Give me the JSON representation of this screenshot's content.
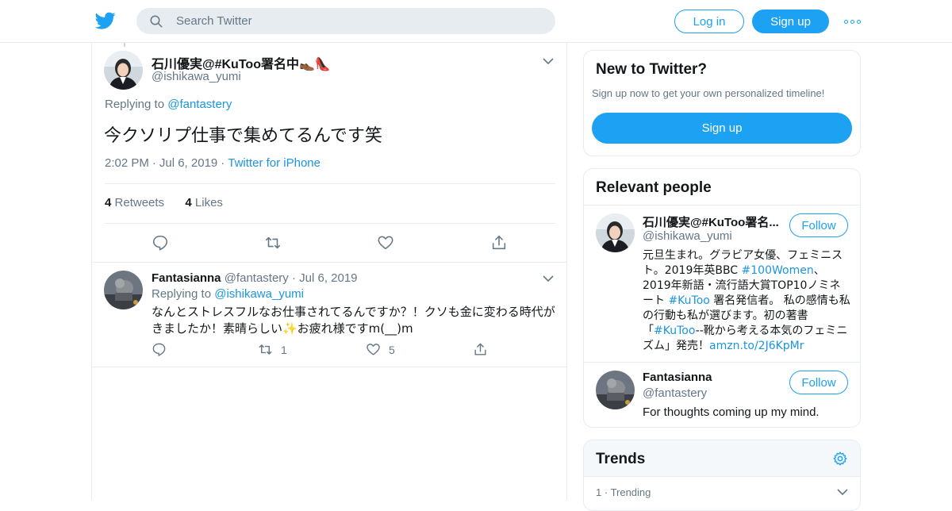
{
  "topbar": {
    "search_placeholder": "Search Twitter",
    "login_label": "Log in",
    "signup_label": "Sign up"
  },
  "main_tweet": {
    "name": "石川優実@#KuToo署名中👞👠",
    "handle": "@ishikawa_yumi",
    "replying_prefix": "Replying to",
    "replying_to": "@fantastery",
    "text": "今クソリプ仕事で集めてるんです笑",
    "time": "2:02 PM",
    "date": "Jul 6, 2019",
    "source": "Twitter for iPhone",
    "retweets_count": "4",
    "retweets_label": "Retweets",
    "likes_count": "4",
    "likes_label": "Likes"
  },
  "reply_tweet": {
    "name": "Fantasianna",
    "handle": "@fantastery",
    "date": "Jul 6, 2019",
    "replying_prefix": "Replying to",
    "replying_to": "@ishikawa_yumi",
    "text": "なんとストレスフルなお仕事されてるんですか？！クソも金に変わる時代がきましたか！素晴らしい✨お疲れ様ですm(__)m",
    "retweets": "1",
    "likes": "5"
  },
  "new_to_twitter": {
    "title": "New to Twitter?",
    "subtitle": "Sign up now to get your own personalized timeline!",
    "button": "Sign up"
  },
  "relevant_people": {
    "title": "Relevant people",
    "follow_label": "Follow",
    "people": [
      {
        "name": "石川優実@#KuToo署名...",
        "handle": "@ishikawa_yumi",
        "bio_1": "元旦生まれ。グラビア女優、フェミニスト。2019年英BBC ",
        "bio_link_1": "#100Women",
        "bio_2": "、2019年新語・流行語大賞TOP10ノミネート ",
        "bio_link_2": "#KuToo",
        "bio_3": " 署名発信者。 私の感情も私の行動も私が選びます。初の著書「",
        "bio_link_3": "#KuToo",
        "bio_4": "--靴から考える本気のフェミニズム」発売！",
        "bio_link_4": "amzn.to/2J6KpMr"
      },
      {
        "name": "Fantasianna",
        "handle": "@fantastery",
        "bio": "For thoughts coming up my mind."
      }
    ]
  },
  "trends": {
    "title": "Trends",
    "first_rank": "1",
    "first_label": "Trending"
  },
  "colors": {
    "accent": "#1da1f2",
    "link": "#1b95e0",
    "muted": "#657786",
    "border": "#e6ecf0"
  }
}
